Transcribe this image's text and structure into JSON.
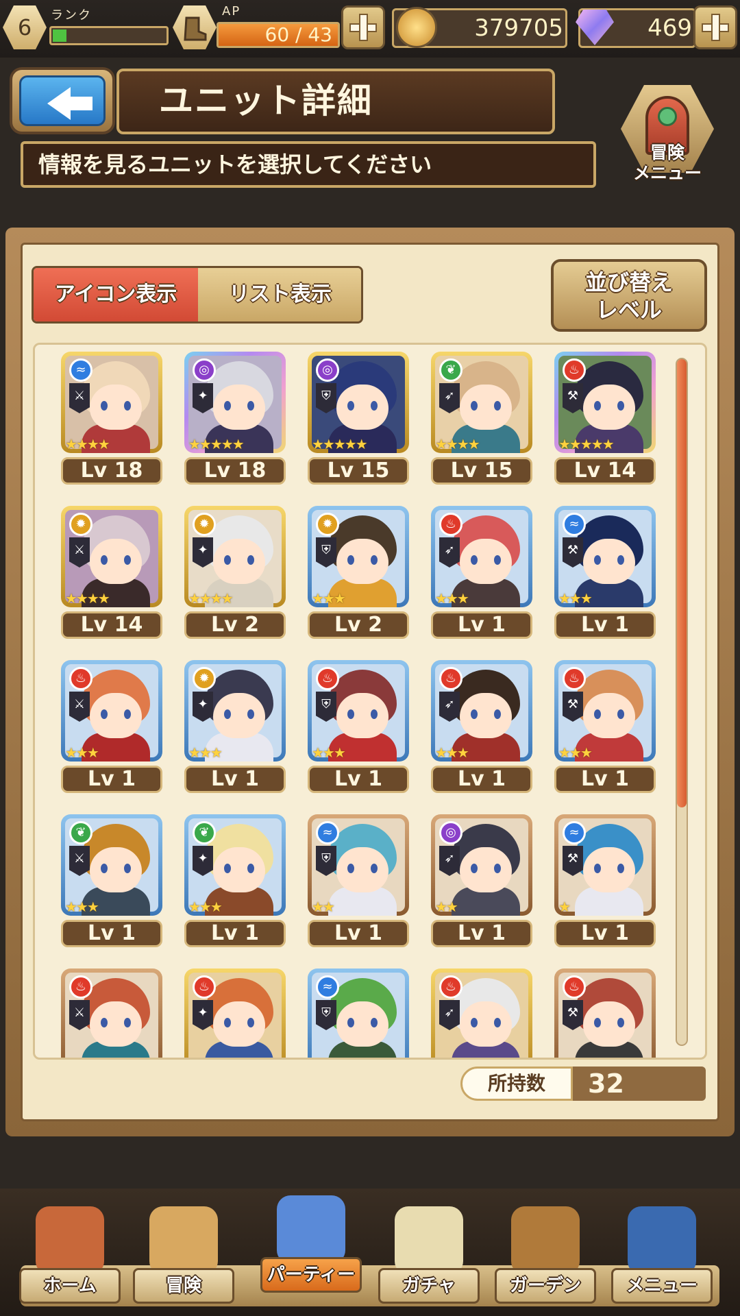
{
  "status": {
    "rank": {
      "value": "6",
      "label": "ランク",
      "progress": 0.12
    },
    "ap": {
      "label": "AP",
      "current": "60",
      "max": "43",
      "text": "60 / 43",
      "progress": 1.0
    },
    "coins": "379705",
    "gems": "469"
  },
  "header": {
    "title": "ユニット詳細",
    "subtitle": "情報を見るユニットを選択してください",
    "adventure_menu_label_line1": "冒険",
    "adventure_menu_label_line2": "メニュー"
  },
  "view_tabs": {
    "icon_view": "アイコン表示",
    "list_view": "リスト表示"
  },
  "sort": {
    "line1": "並び替え",
    "line2": "レベル"
  },
  "units": [
    {
      "level": "Lv 18",
      "stars": 4,
      "element": "water",
      "element_color": "#2f7de0",
      "frame": "gold",
      "hair": "#f0d8b8",
      "outfit": "#b03a3a",
      "bg": "#d8c0a8"
    },
    {
      "level": "Lv 18",
      "stars": 5,
      "element": "dark",
      "element_color": "#8a3fc9",
      "frame": "rainbow",
      "hair": "#d8d8e0",
      "outfit": "#3a3458",
      "bg": "#b8b0c8"
    },
    {
      "level": "Lv 15",
      "stars": 5,
      "element": "dark",
      "element_color": "#8a3fc9",
      "frame": "gold",
      "hair": "#2a3a7a",
      "outfit": "#2a2a5a",
      "bg": "#3a4a7a"
    },
    {
      "level": "Lv 15",
      "stars": 4,
      "element": "wind",
      "element_color": "#3aa84a",
      "frame": "gold",
      "hair": "#d8b48a",
      "outfit": "#3a7a8a",
      "bg": "#e8d0a8"
    },
    {
      "level": "Lv 14",
      "stars": 5,
      "element": "fire",
      "element_color": "#e03a2a",
      "frame": "rainbow",
      "hair": "#2a2a40",
      "outfit": "#4a3a6a",
      "bg": "#6a8a5a"
    },
    {
      "level": "Lv 14",
      "stars": 4,
      "element": "light",
      "element_color": "#e0a020",
      "frame": "gold",
      "hair": "#d8c8d0",
      "outfit": "#3a2a2a",
      "bg": "#b89ab8"
    },
    {
      "level": "Lv 2",
      "stars": 4,
      "element": "light",
      "element_color": "#e0a020",
      "frame": "gold",
      "hair": "#e8e8e8",
      "outfit": "#d8d0c0",
      "bg": "#e8dcc8"
    },
    {
      "level": "Lv 2",
      "stars": 3,
      "element": "light",
      "element_color": "#e0a020",
      "frame": "blue",
      "hair": "#4a3a2a",
      "outfit": "#e0a030",
      "bg": "#c8dcf0"
    },
    {
      "level": "Lv 1",
      "stars": 3,
      "element": "fire",
      "element_color": "#e03a2a",
      "frame": "blue",
      "hair": "#d85a5a",
      "outfit": "#4a3a3a",
      "bg": "#c8dcf0"
    },
    {
      "level": "Lv 1",
      "stars": 3,
      "element": "water",
      "element_color": "#2f7de0",
      "frame": "blue",
      "hair": "#1a2a5a",
      "outfit": "#2a3a6a",
      "bg": "#c8dcf0"
    },
    {
      "level": "Lv 1",
      "stars": 3,
      "element": "fire",
      "element_color": "#e03a2a",
      "frame": "blue",
      "hair": "#e07a4a",
      "outfit": "#b02a2a",
      "bg": "#c8dcf0"
    },
    {
      "level": "Lv 1",
      "stars": 3,
      "element": "light",
      "element_color": "#e0a020",
      "frame": "blue",
      "hair": "#3a3a50",
      "outfit": "#e8e8f0",
      "bg": "#c8dcf0"
    },
    {
      "level": "Lv 1",
      "stars": 3,
      "element": "fire",
      "element_color": "#e03a2a",
      "frame": "blue",
      "hair": "#8a3a3a",
      "outfit": "#c03030",
      "bg": "#c8dcf0"
    },
    {
      "level": "Lv 1",
      "stars": 3,
      "element": "fire",
      "element_color": "#e03a2a",
      "frame": "blue",
      "hair": "#3a2a20",
      "outfit": "#a0302a",
      "bg": "#c8dcf0"
    },
    {
      "level": "Lv 1",
      "stars": 3,
      "element": "fire",
      "element_color": "#e03a2a",
      "frame": "blue",
      "hair": "#d8905a",
      "outfit": "#c03a3a",
      "bg": "#c8dcf0"
    },
    {
      "level": "Lv 1",
      "stars": 3,
      "element": "wind",
      "element_color": "#3aa84a",
      "frame": "blue",
      "hair": "#c8882a",
      "outfit": "#3a4a5a",
      "bg": "#c8dcf0"
    },
    {
      "level": "Lv 1",
      "stars": 3,
      "element": "wind",
      "element_color": "#3aa84a",
      "frame": "blue",
      "hair": "#f0e0a0",
      "outfit": "#8a4a2a",
      "bg": "#c8dcf0"
    },
    {
      "level": "Lv 1",
      "stars": 2,
      "element": "water",
      "element_color": "#2f7de0",
      "frame": "bronze",
      "hair": "#5ab0c8",
      "outfit": "#e8e8f0",
      "bg": "#e8d8c0"
    },
    {
      "level": "Lv 1",
      "stars": 2,
      "element": "dark",
      "element_color": "#8a3fc9",
      "frame": "bronze",
      "hair": "#3a3a4a",
      "outfit": "#4a4a5a",
      "bg": "#e8d8c0"
    },
    {
      "level": "Lv 1",
      "stars": 1,
      "element": "water",
      "element_color": "#2f7de0",
      "frame": "bronze",
      "hair": "#3a90c8",
      "outfit": "#e8e8f0",
      "bg": "#e8d8c0"
    },
    {
      "level": "",
      "stars": 0,
      "element": "fire",
      "element_color": "#e03a2a",
      "frame": "bronze",
      "hair": "#c85a3a",
      "outfit": "#2a7a8a",
      "bg": "#e8d8c0"
    },
    {
      "level": "",
      "stars": 0,
      "element": "fire",
      "element_color": "#e03a2a",
      "frame": "gold",
      "hair": "#d8703a",
      "outfit": "#3a5aa0",
      "bg": "#e8d0a0"
    },
    {
      "level": "",
      "stars": 0,
      "element": "water",
      "element_color": "#2f7de0",
      "frame": "blue",
      "hair": "#5aaa4a",
      "outfit": "#3a5a3a",
      "bg": "#c8dcf0"
    },
    {
      "level": "",
      "stars": 0,
      "element": "fire",
      "element_color": "#e03a2a",
      "frame": "gold",
      "hair": "#e8e8e8",
      "outfit": "#5a4a8a",
      "bg": "#e8d0a0"
    },
    {
      "level": "",
      "stars": 0,
      "element": "fire",
      "element_color": "#e03a2a",
      "frame": "bronze",
      "hair": "#b04a3a",
      "outfit": "#3a3a3a",
      "bg": "#e8d8c0"
    }
  ],
  "owned": {
    "label": "所持数",
    "count": "32"
  },
  "nav": [
    {
      "label": "ホーム",
      "icon": "house-icon"
    },
    {
      "label": "冒険",
      "icon": "compass-icon"
    },
    {
      "label": "パーティー",
      "icon": "chess-icon",
      "active": true
    },
    {
      "label": "ガチャ",
      "icon": "dice-icon"
    },
    {
      "label": "ガーデン",
      "icon": "basket-icon"
    },
    {
      "label": "メニュー",
      "icon": "book-icon"
    }
  ]
}
